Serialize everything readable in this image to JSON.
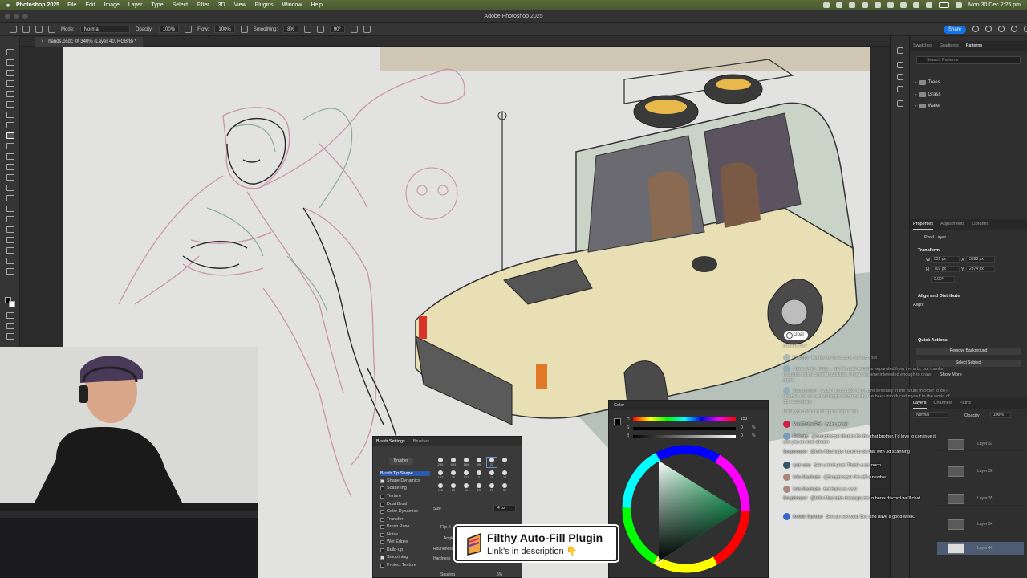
{
  "menubar": {
    "app_name": "Photoshop 2025",
    "items": [
      "File",
      "Edit",
      "Image",
      "Layer",
      "Type",
      "Select",
      "Filter",
      "3D",
      "View",
      "Plugins",
      "Window",
      "Help"
    ],
    "datetime": "Mon 30 Dec  2:25 pm"
  },
  "window": {
    "title": "Adobe Photoshop 2025"
  },
  "options_bar": {
    "mode_label": "Mode:",
    "mode_value": "Normal",
    "opacity_label": "Opacity:",
    "opacity_value": "100%",
    "flow_label": "Flow:",
    "flow_value": "100%",
    "smoothing_label": "Smoothing:",
    "smoothing_value": "8%",
    "angle_value": "90°",
    "share_label": "Share"
  },
  "document": {
    "tab_label": "hands.psdc @ 340% (Layer 40, RGB/8) *"
  },
  "patterns_panel": {
    "tabs": [
      "Swatches",
      "Gradients",
      "Patterns"
    ],
    "active_tab": "Patterns",
    "search_placeholder": "Search Patterns",
    "folders": [
      "Trees",
      "Grass",
      "Water"
    ]
  },
  "properties_panel": {
    "tabs": [
      "Properties",
      "Adjustments",
      "Libraries"
    ],
    "layer_type": "Pixel Layer",
    "transform_heading": "Transform",
    "w_label": "W",
    "w_value": "531 px",
    "h_label": "H",
    "h_value": "701 px",
    "x_label": "X",
    "x_value": "3393 px",
    "y_label": "Y",
    "y_value": "2874 px",
    "angle_value": "0.00°",
    "align_heading": "Align and Distribute",
    "align_label": "Align:",
    "quick_actions_heading": "Quick Actions",
    "remove_bg_label": "Remove Background",
    "select_subject_label": "Select Subject"
  },
  "layers_panel": {
    "tabs": [
      "Layers",
      "Channels",
      "Paths"
    ],
    "blend_mode": "Normal",
    "opacity_label": "Opacity:",
    "opacity_value": "100%",
    "layer_names": [
      "Layer 37",
      "Layer 36",
      "Layer 35",
      "Layer 34",
      "Layer 40"
    ]
  },
  "chat": {
    "goal_label": "Goal",
    "show_more_label": "Show More",
    "faded_lines": [
      {
        "user": "",
        "text": "great horse!"
      },
      {
        "user": "Fefcapy",
        "text": "thanks for the brother to hang out"
      },
      {
        "user": "",
        "text": "I have been doing ... my life path became separated from the arts, but thanks to all the online content available, I have become interested enough to draw again."
      },
      {
        "user": "Souptrooper",
        "text": "I wish I could take this more seriously in the future in order to do it like Ben. I'm an archaeologist and recently I've been introduced myself to the world of 3D recreations"
      },
      {
        "user": "",
        "text": "thank you Ben for being an inspiration"
      }
    ],
    "lines": [
      {
        "user": "RealOnlinePhil",
        "text": "looks great!"
      },
      {
        "user": "Fefcapy",
        "text": "@Souptrooper thanks for the chat brother, I'd love to continue it. see you on next stream"
      },
      {
        "user": "Souptrooper",
        "text": "@Inês Machado I used to do that with 3d scanning"
      },
      {
        "user": "ryan woo",
        "text": "See u next year! Thank u so much"
      },
      {
        "user": "Inês Machado",
        "text": "@Souptrooper I'm still a newbie"
      },
      {
        "user": "Inês Machado",
        "text": "but that's so cool"
      },
      {
        "user": "Souptrooper",
        "text": "@Inês Machado message me in ben's discord we'll chat"
      },
      {
        "user": "Artistic Spartan",
        "text": "See ya next year Ben and have a good week."
      }
    ]
  },
  "brush_settings": {
    "tabs": [
      "Brush Settings",
      "Brushes"
    ],
    "brushes_button": "Brushes",
    "items": [
      "Brush Tip Shape",
      "Shape Dynamics",
      "Scattering",
      "Texture",
      "Dual Brush",
      "Color Dynamics",
      "Transfer",
      "Brush Pose",
      "Noise",
      "Wet Edges",
      "Build-up",
      "Smoothing",
      "Protect Texture"
    ],
    "checked": [
      false,
      true,
      false,
      false,
      false,
      false,
      false,
      false,
      false,
      false,
      false,
      true,
      false
    ],
    "tip_sizes": [
      "295",
      "695",
      "186",
      "398",
      "22",
      "7",
      "137",
      "30",
      "123",
      "9",
      "10",
      "25",
      "112",
      "60",
      "50",
      "25",
      "25",
      "50"
    ],
    "size_label": "Size",
    "size_value": "4 px",
    "flip_label": "Flip X",
    "angle_label": "Angle",
    "roundness_label": "Roundness",
    "hardness_label": "Hardness",
    "spacing_label": "Spacing",
    "spacing_value": "5%"
  },
  "promo": {
    "title": "Filthy Auto-Fill Plugin",
    "subtitle": "Link's in description 👇"
  },
  "color_panel": {
    "title": "Color",
    "h_label": "H",
    "h_value": "153",
    "s_label": "S",
    "s_value": "0",
    "s_unit": "%",
    "b_label": "B",
    "b_value": "0",
    "b_unit": "%"
  },
  "colors": {
    "accent": "#1473e6",
    "canvas_bg": "#e2e2e1",
    "car_body": "#e9dfb4",
    "car_shadow": "#8fa69a",
    "sketch_pink": "#c98aa8",
    "sketch_green": "#7fa88e"
  }
}
